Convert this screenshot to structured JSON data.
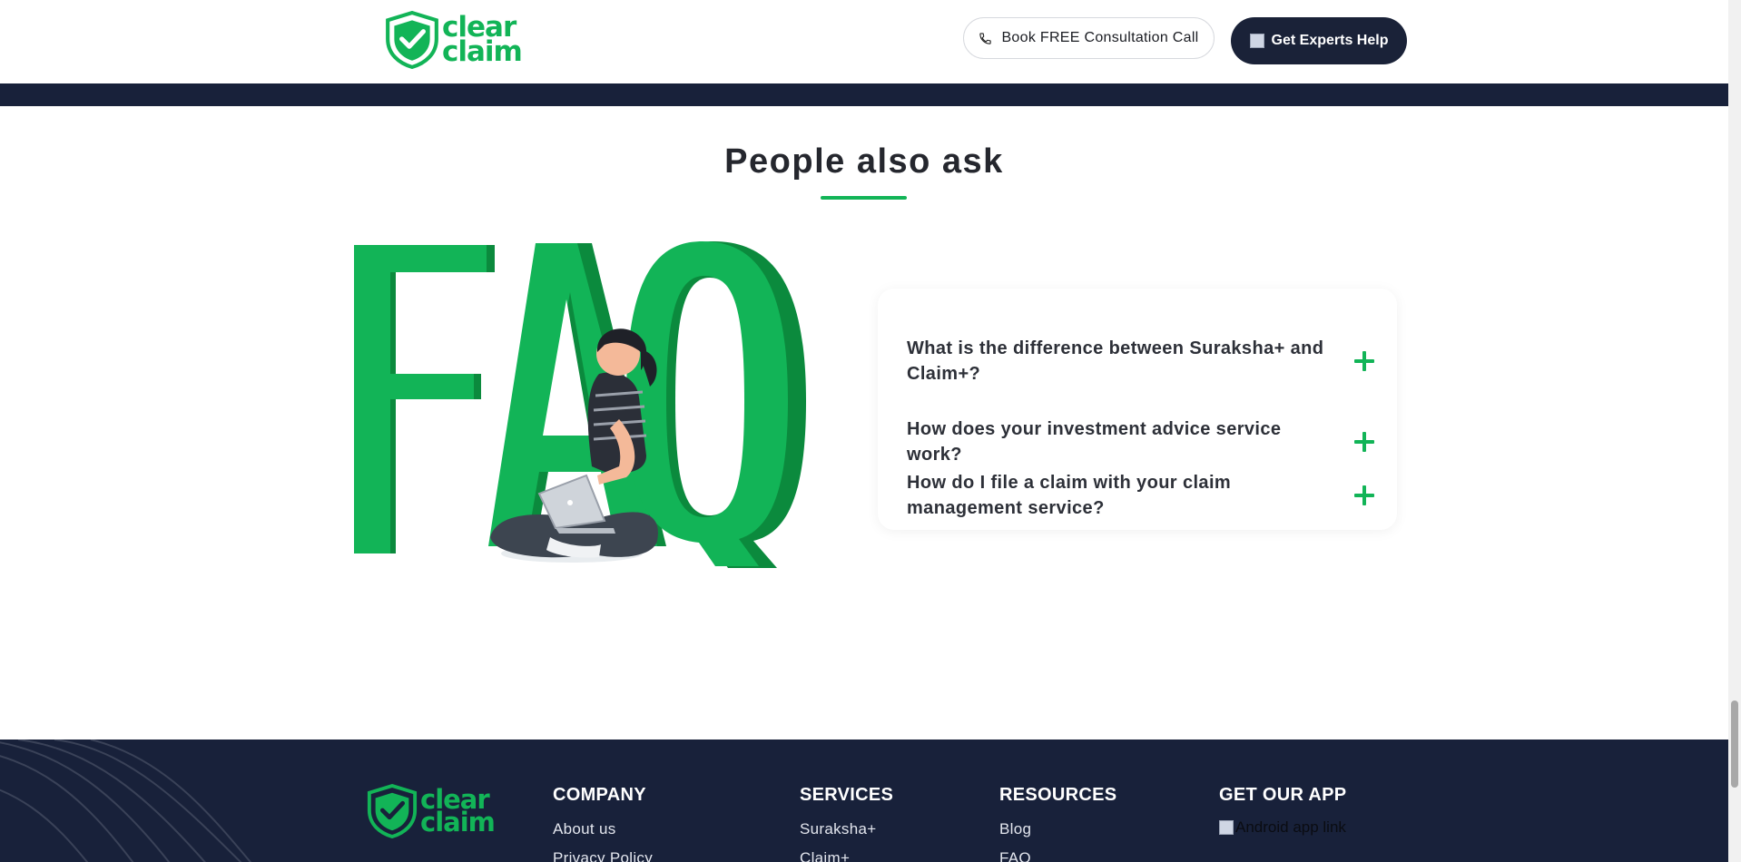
{
  "header": {
    "logo_line1": "clear",
    "logo_line2": "claim",
    "consult_label": "Book FREE Consultation Call",
    "experts_label": "Get Experts Help"
  },
  "faq": {
    "title": "People also ask",
    "questions": [
      "What is the difference between Suraksha+ and Claim+?",
      "How does your investment advice service work?",
      "How do I file a claim with your claim management service?"
    ]
  },
  "footer": {
    "logo_line1": "clear",
    "logo_line2": "claim",
    "company": {
      "heading": "COMPANY",
      "links": [
        "About us",
        "Privacy Policy"
      ]
    },
    "services": {
      "heading": "SERVICES",
      "links": [
        "Suraksha+",
        "Claim+"
      ]
    },
    "resources": {
      "heading": "RESOURCES",
      "links": [
        "Blog",
        "FAQ"
      ]
    },
    "app": {
      "heading": "GET OUR APP",
      "android_alt": "Android app link"
    }
  },
  "colors": {
    "brand_green": "#12b457",
    "navy": "#18213a",
    "text_dark": "#25272e"
  }
}
